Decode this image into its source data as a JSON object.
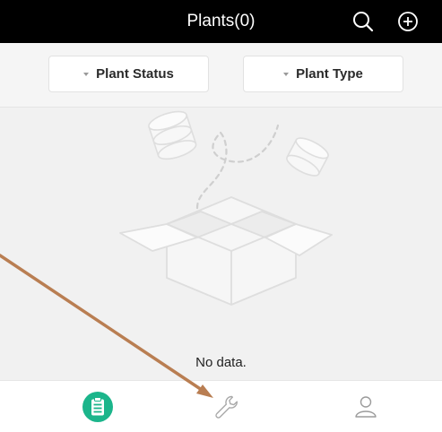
{
  "header": {
    "title": "Plants(0)",
    "search_icon": "search-icon",
    "add_icon": "add-circle-icon"
  },
  "filters": {
    "status_label": "Plant Status",
    "type_label": "Plant Type"
  },
  "empty_state": {
    "illustration": "empty-box-illustration",
    "message": "No data."
  },
  "tabbar": {
    "tabs": [
      {
        "icon": "clipboard-icon",
        "active": true
      },
      {
        "icon": "wrench-icon",
        "active": false
      },
      {
        "icon": "user-icon",
        "active": false
      }
    ]
  },
  "colors": {
    "header_bg": "#000000",
    "accent": "#1bb58b",
    "annotation_arrow": "#b97e52",
    "inactive_icon": "#9b9b9b"
  }
}
